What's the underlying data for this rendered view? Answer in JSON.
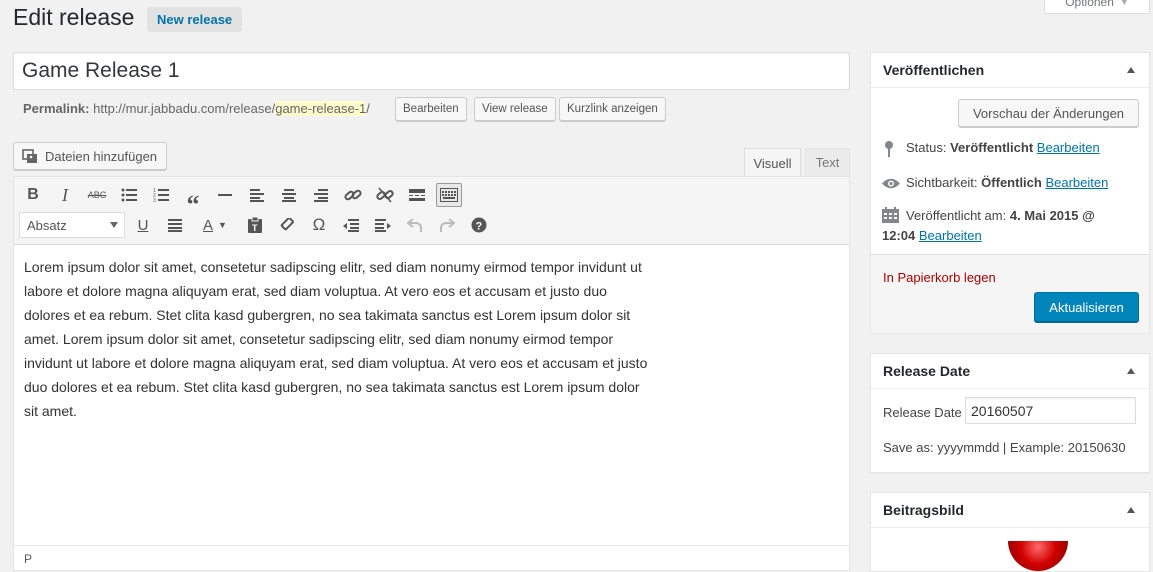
{
  "header": {
    "title": "Edit release",
    "new_button": "New release",
    "screen_options": "Optionen"
  },
  "post": {
    "title_value": "Game Release 1",
    "permalink_label": "Permalink:",
    "permalink_base": "http://mur.jabbadu.com/release/",
    "permalink_slug": "game-release-1",
    "permalink_trailing": "/",
    "edit_slug_button": "Bearbeiten",
    "view_button": "View release",
    "shortlink_button": "Kurzlink anzeigen"
  },
  "editor": {
    "add_media": "Dateien hinzufügen",
    "tab_visual": "Visuell",
    "tab_text": "Text",
    "format_select": "Absatz",
    "content": "Lorem ipsum dolor sit amet, consetetur sadipscing elitr, sed diam nonumy eirmod tempor invidunt ut labore et dolore magna aliquyam erat, sed diam voluptua. At vero eos et accusam et justo duo dolores et ea rebum. Stet clita kasd gubergren, no sea takimata sanctus est Lorem ipsum dolor sit amet. Lorem ipsum dolor sit amet, consetetur sadipscing elitr, sed diam nonumy eirmod tempor invidunt ut labore et dolore magna aliquyam erat, sed diam voluptua. At vero eos et accusam et justo duo dolores et ea rebum. Stet clita kasd gubergren, no sea takimata sanctus est Lorem ipsum dolor sit amet.",
    "path": "P"
  },
  "publish": {
    "title": "Veröffentlichen",
    "preview_button": "Vorschau der Änderungen",
    "status_label": "Status:",
    "status_value": "Veröffentlicht",
    "visibility_label": "Sichtbarkeit:",
    "visibility_value": "Öffentlich",
    "published_label": "Veröffentlicht am:",
    "published_date": "4. Mai 2015 @",
    "published_time": "12:04",
    "edit_link": "Bearbeiten",
    "trash_link": "In Papierkorb legen",
    "update_button": "Aktualisieren"
  },
  "release_date": {
    "title": "Release Date",
    "label": "Release Date",
    "value": "20160507",
    "hint": "Save as: yyyymmdd | Example: 20150630"
  },
  "featured_image": {
    "title": "Beitragsbild"
  },
  "colors": {
    "accent": "#0073aa",
    "primary_button": "#0085ba",
    "trash": "#a00",
    "slug_highlight": "#fffbcc"
  },
  "icons": [
    "pin-icon",
    "eye-icon",
    "calendar-icon",
    "media-icon",
    "bold-icon",
    "italic-icon",
    "strikethrough-icon",
    "bullet-list-icon",
    "numbered-list-icon",
    "blockquote-icon",
    "horizontal-rule-icon",
    "align-left-icon",
    "align-center-icon",
    "align-right-icon",
    "link-icon",
    "unlink-icon",
    "read-more-icon",
    "toolbar-toggle-icon",
    "underline-icon",
    "justify-icon",
    "text-color-icon",
    "paste-text-icon",
    "clear-format-icon",
    "special-char-icon",
    "outdent-icon",
    "indent-icon",
    "undo-icon",
    "redo-icon",
    "help-icon"
  ]
}
